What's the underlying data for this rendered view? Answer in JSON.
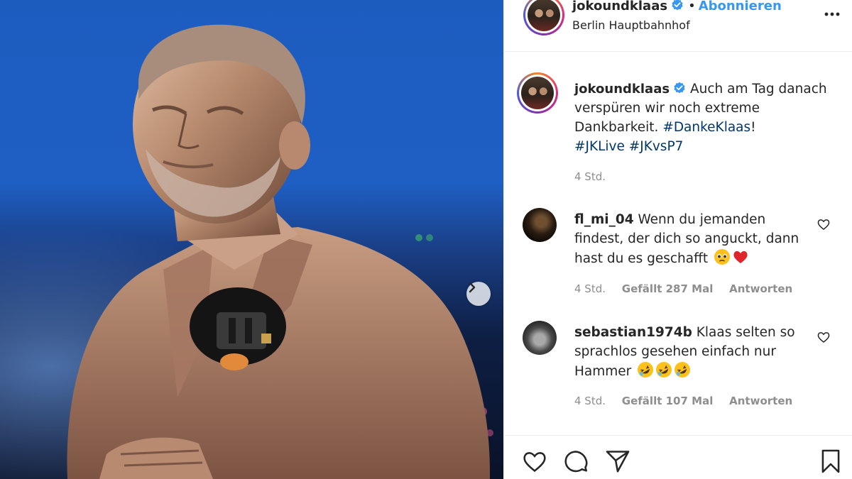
{
  "header": {
    "username": "jokoundklaas",
    "separator": "•",
    "follow_label": "Abonnieren",
    "location": "Berlin Hauptbahnhof"
  },
  "caption": {
    "username": "jokoundklaas",
    "text": "Auch am Tag danach verspüren wir noch extreme Dankbarkeit.",
    "hashtag1": "#DankeKlaas",
    "exclaim": "!",
    "hashtag2": "#JKLive",
    "hashtag3": "#JKvsP7",
    "time": "4 Std."
  },
  "comments": [
    {
      "username": "fl_mi_04",
      "text": "Wenn du jemanden findest, der dich so anguckt, dann hast du es geschafft",
      "time": "4 Std.",
      "likes": "Gefällt 287 Mal",
      "reply": "Antworten",
      "emojis": [
        "pleading-face-icon",
        "red-heart-icon"
      ]
    },
    {
      "username": "sebastian1974b",
      "text": "Klaas selten so sprachlos gesehen einfach nur Hammer",
      "time": "4 Std.",
      "likes": "Gefällt 107 Mal",
      "reply": "Antworten",
      "emojis": [
        "rolling-laughing-icon",
        "rolling-laughing-icon",
        "rolling-laughing-icon"
      ]
    }
  ],
  "icons": {
    "more": "more-options-icon",
    "next": "chevron-right-icon",
    "verified": "verified-badge-icon",
    "like": "heart-icon",
    "comment": "comment-icon",
    "share": "share-icon",
    "save": "bookmark-icon"
  },
  "colors": {
    "link": "#3897f0",
    "hashtag": "#00376b",
    "muted": "#8e8e8e",
    "verified": "#3897f0",
    "sky": "#1f5fc4",
    "bronze": "#b78a6e"
  }
}
